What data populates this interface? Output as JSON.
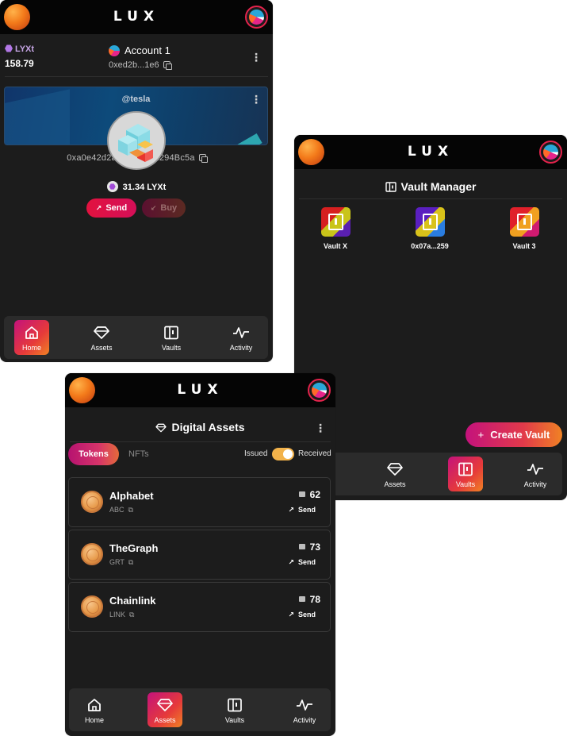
{
  "brand": "LUX",
  "home": {
    "token_symbol": "LYXt",
    "token_balance": "158.79",
    "account_name": "Account 1",
    "account_address": "0xed2b...1e6",
    "profile_handle": "@tesla",
    "profile_address": "0xa0e42d2a49e...26d1294Bc5a",
    "profile_balance": "31.34 LYXt",
    "send_label": "Send",
    "buy_label": "Buy"
  },
  "nav": {
    "home": "Home",
    "assets": "Assets",
    "vaults": "Vaults",
    "activity": "Activity"
  },
  "vault_manager": {
    "title": "Vault Manager",
    "vaults": [
      {
        "name": "Vault X",
        "colors": [
          "#d61f1f",
          "#c9c41a",
          "#5a1fb0"
        ]
      },
      {
        "name": "0x07a...259",
        "colors": [
          "#5a1fc0",
          "#d8c21a",
          "#2a7de0"
        ]
      },
      {
        "name": "Vault 3",
        "colors": [
          "#e0202a",
          "#f0a020",
          "#d01a70"
        ]
      }
    ],
    "create_label": "Create Vault"
  },
  "digital_assets": {
    "title": "Digital Assets",
    "tab_tokens": "Tokens",
    "tab_nfts": "NFTs",
    "toggle_left": "Issued",
    "toggle_right": "Received",
    "toggle_on": true,
    "items": [
      {
        "name": "Alphabet",
        "symbol": "ABC",
        "amount": "62",
        "action": "Send"
      },
      {
        "name": "TheGraph",
        "symbol": "GRT",
        "amount": "73",
        "action": "Send"
      },
      {
        "name": "Chainlink",
        "symbol": "LINK",
        "amount": "78",
        "action": "Send"
      }
    ]
  },
  "colors": {
    "accent_start": "#c4127c",
    "accent_end": "#f08224",
    "send_red": "#e2123f",
    "background": "#1c1c1c"
  }
}
